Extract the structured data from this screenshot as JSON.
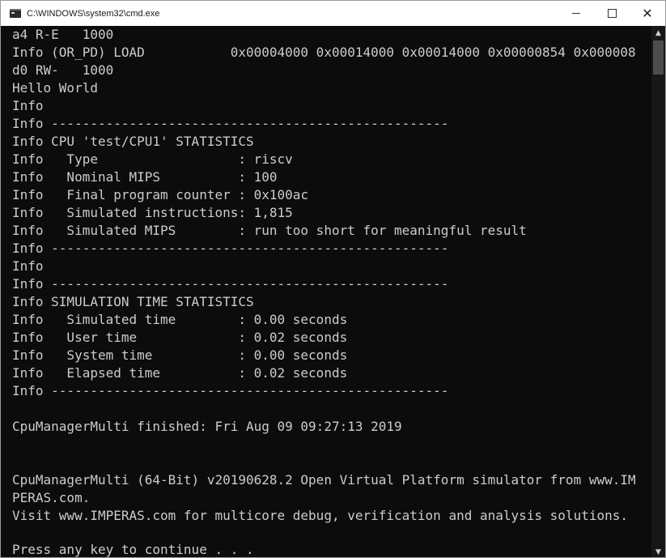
{
  "window": {
    "title": "C:\\WINDOWS\\system32\\cmd.exe",
    "controls": {
      "minimize": "–",
      "close": "✕"
    }
  },
  "console": {
    "lines": [
      "a4 R-E   1000",
      "Info (OR_PD) LOAD           0x00004000 0x00014000 0x00014000 0x00000854 0x000008",
      "d0 RW-   1000",
      "Hello World",
      "Info",
      "Info ---------------------------------------------------",
      "Info CPU 'test/CPU1' STATISTICS",
      "Info   Type                  : riscv",
      "Info   Nominal MIPS          : 100",
      "Info   Final program counter : 0x100ac",
      "Info   Simulated instructions: 1,815",
      "Info   Simulated MIPS        : run too short for meaningful result",
      "Info ---------------------------------------------------",
      "Info",
      "Info ---------------------------------------------------",
      "Info SIMULATION TIME STATISTICS",
      "Info   Simulated time        : 0.00 seconds",
      "Info   User time             : 0.02 seconds",
      "Info   System time           : 0.00 seconds",
      "Info   Elapsed time          : 0.02 seconds",
      "Info ---------------------------------------------------",
      "",
      "CpuManagerMulti finished: Fri Aug 09 09:27:13 2019",
      "",
      "",
      "CpuManagerMulti (64-Bit) v20190628.2 Open Virtual Platform simulator from www.IM",
      "PERAS.com.",
      "Visit www.IMPERAS.com for multicore debug, verification and analysis solutions.",
      "",
      "Press any key to continue . . ."
    ]
  },
  "scrollbar": {
    "up_arrow": "▲",
    "down_arrow": "▼"
  },
  "colors": {
    "console_bg": "#0c0c0c",
    "console_text": "#cccccc",
    "titlebar_bg": "#ffffff"
  }
}
